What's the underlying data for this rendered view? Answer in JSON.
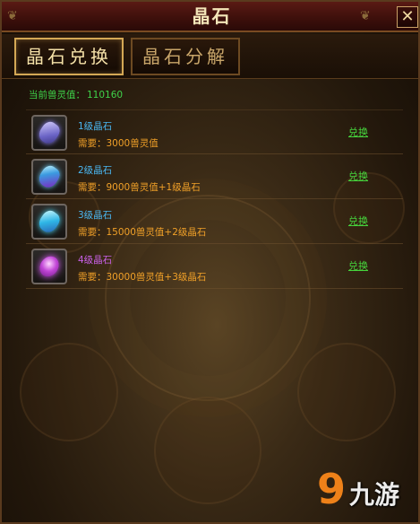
{
  "window": {
    "title": "晶石",
    "close_glyph": "✕"
  },
  "tabs": [
    {
      "label": "晶石兑换",
      "active": true
    },
    {
      "label": "晶石分解",
      "active": false
    }
  ],
  "beast_value": {
    "label": "当前兽灵值：",
    "value": "110160"
  },
  "items": [
    {
      "name": "1级晶石",
      "requirement": "需要：3000兽灵值",
      "action": "兑换",
      "icon": "blue-crystal-icon",
      "name_color": "#4ab6f0"
    },
    {
      "name": "2级晶石",
      "requirement": "需要：9000兽灵值+1级晶石",
      "action": "兑换",
      "icon": "cyan-purple-crystal-icon",
      "name_color": "#4ab6f0"
    },
    {
      "name": "3级晶石",
      "requirement": "需要：15000兽灵值+2级晶石",
      "action": "兑换",
      "icon": "cyan-crystal-icon",
      "name_color": "#4ab6f0"
    },
    {
      "name": "4级晶石",
      "requirement": "需要：30000兽灵值+3级晶石",
      "action": "兑换",
      "icon": "purple-crystal-icon",
      "name_color": "#c860e8"
    }
  ],
  "watermark": {
    "glyph": "9",
    "text": "九游"
  },
  "colors": {
    "title": "#f4e6b8",
    "requirement": "#f0a028",
    "action": "#46d43c",
    "value_line": "#3fd24a"
  }
}
